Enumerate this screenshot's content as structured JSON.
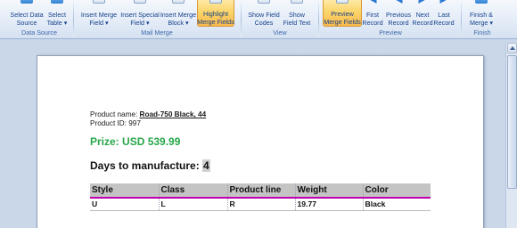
{
  "ribbon": {
    "buttons": [
      {
        "id": "select-data-source",
        "lines": [
          "Select Data",
          "Source"
        ],
        "active": false
      },
      {
        "id": "select-table",
        "lines": [
          "Select",
          "Table ▾"
        ],
        "active": false
      },
      {
        "id": "insert-merge-field",
        "lines": [
          "Insert Merge",
          "Field ▾"
        ],
        "active": false
      },
      {
        "id": "insert-special-field",
        "lines": [
          "Insert Special",
          "Field ▾"
        ],
        "active": false
      },
      {
        "id": "insert-merge-block",
        "lines": [
          "Insert Merge",
          "Block ▾"
        ],
        "active": false
      },
      {
        "id": "highlight-merge-fields",
        "lines": [
          "Highlight",
          "Merge Fields"
        ],
        "active": true
      },
      {
        "id": "show-field-codes",
        "lines": [
          "Show Field",
          "Codes"
        ],
        "active": false
      },
      {
        "id": "show-field-text",
        "lines": [
          "Show",
          "Field Text"
        ],
        "active": false
      },
      {
        "id": "preview-merge-fields",
        "lines": [
          "Preview",
          "Merge Fields"
        ],
        "active": true
      },
      {
        "id": "first-record",
        "lines": [
          "First",
          "Record"
        ],
        "active": false
      },
      {
        "id": "previous-record",
        "lines": [
          "Previous",
          "Record"
        ],
        "active": false
      },
      {
        "id": "next-record",
        "lines": [
          "Next",
          "Record"
        ],
        "active": false
      },
      {
        "id": "last-record",
        "lines": [
          "Last",
          "Record"
        ],
        "active": false
      },
      {
        "id": "finish-and-merge",
        "lines": [
          "Finish &",
          "Merge ▾"
        ],
        "active": false
      }
    ],
    "groups": [
      "Data Source",
      "Mail Merge",
      "View",
      "Preview",
      "Finish"
    ]
  },
  "document": {
    "product_name_label": "Product name:",
    "product_name_value": "Road-750 Black, 44",
    "product_id_label": "Product ID:",
    "product_id_value": "997",
    "price_label": "Prize:",
    "price_value": "USD 539.99",
    "days_label": "Days to manufacture:",
    "days_value": "4",
    "table": {
      "headers": [
        "Style",
        "Class",
        "Product line",
        "Weight",
        "Color"
      ],
      "row": [
        "U",
        "L",
        "R",
        "19.77",
        "Black"
      ]
    }
  },
  "colors": {
    "price_green": "#27a84a",
    "table_header_bg": "#c4c4c4",
    "table_underline": "#c000b0",
    "active_button": "#fbd56a"
  }
}
